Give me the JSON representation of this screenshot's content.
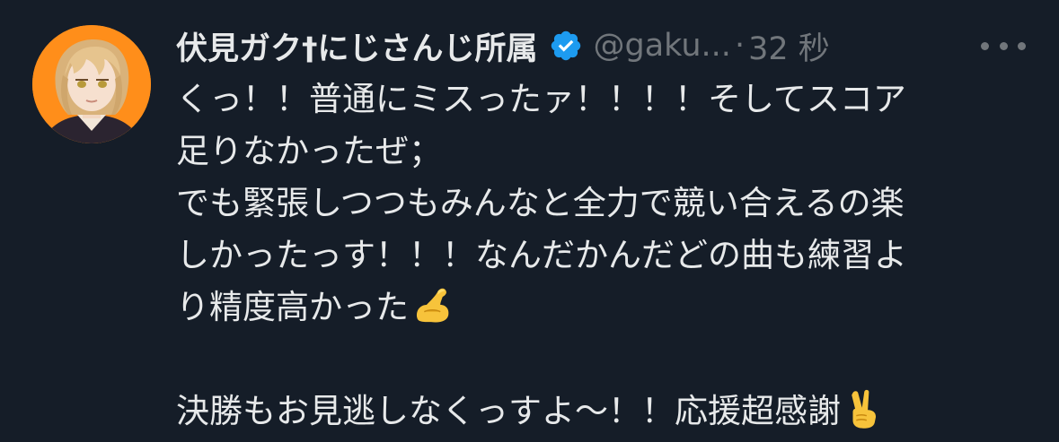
{
  "tweet": {
    "author": {
      "display_name": "伏見ガク†にじさんじ所属",
      "handle": "@gaku...",
      "verified_icon": "verified-badge-icon",
      "verified_color": "#1d9bf0"
    },
    "separator": "·",
    "timestamp": "32 秒",
    "more_icon": "more-horizontal-icon",
    "text_lines": [
      "くっ！！普通にミスったァ！！！！そしてスコア",
      "足りなかったぜ；",
      "でも緊張しつつもみんなと全力で競い合えるの楽",
      "しかったっす！！！なんだかんだどの曲も練習よ",
      "り精度高かった",
      "",
      "決勝もお見逃しなくっすよ〜！！応援超感謝"
    ],
    "emojis": {
      "line5": "flexed-biceps-emoji",
      "line7": "victory-hand-emoji"
    }
  },
  "colors": {
    "background": "#151d28",
    "text": "#e7e9ea",
    "secondary_text": "#71767b",
    "avatar_bg": "#ff8e1a"
  }
}
